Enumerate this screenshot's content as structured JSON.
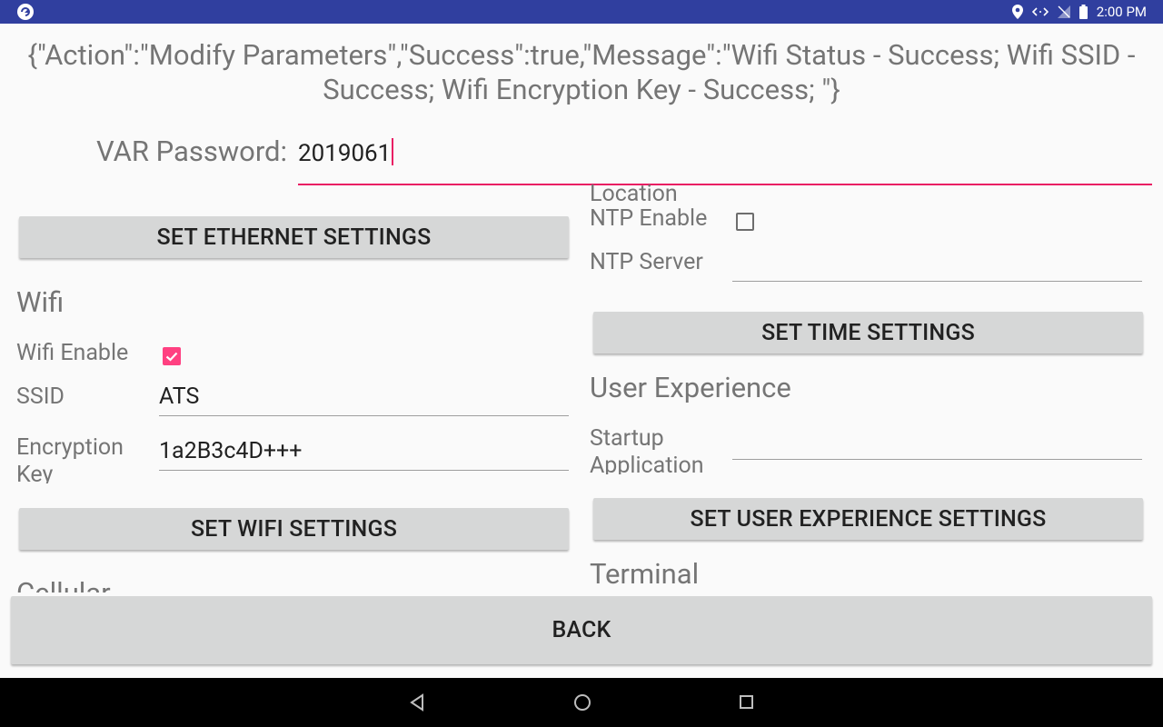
{
  "status_bar": {
    "time": "2:00 PM"
  },
  "response_message": "{\"Action\":\"Modify Parameters\",\"Success\":true,\"Message\":\"Wifi Status - Success; Wifi SSID - Success; Wifi Encryption Key - Success; \"}",
  "var_password": {
    "label": "VAR Password:",
    "value": "2019061"
  },
  "left": {
    "ethernet_button": "SET ETHERNET SETTINGS",
    "wifi_heading": "Wifi",
    "wifi_enable_label": "Wifi Enable",
    "wifi_enable_checked": true,
    "ssid_label": "SSID",
    "ssid_value": "ATS",
    "encryption_label": "Encryption Key",
    "encryption_value": "1a2B3c4D+++",
    "wifi_button": "SET WIFI SETTINGS",
    "cellular_heading": "Cellular"
  },
  "right": {
    "location_label": "Location",
    "ntp_enable_label": "NTP Enable",
    "ntp_enable_checked": false,
    "ntp_server_label": "NTP Server",
    "ntp_server_value": "",
    "time_button": "SET TIME SETTINGS",
    "ux_heading": "User Experience",
    "startup_label": "Startup Application",
    "startup_value": "",
    "ux_button": "SET USER EXPERIENCE SETTINGS",
    "terminal_heading": "Terminal"
  },
  "back_button": "BACK",
  "colors": {
    "status_bar": "#303f9f",
    "accent": "#e91e63",
    "checkbox": "#ff4081",
    "button": "#d6d7d7"
  }
}
